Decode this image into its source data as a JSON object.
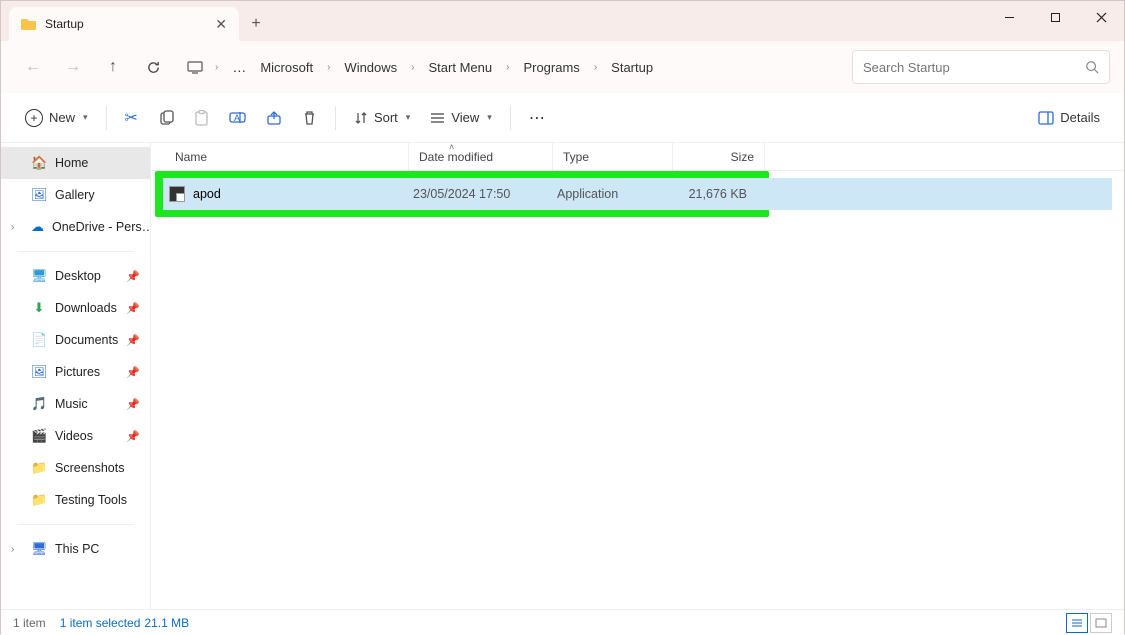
{
  "window": {
    "title": "Startup"
  },
  "breadcrumb": {
    "items": [
      "Microsoft",
      "Windows",
      "Start Menu",
      "Programs",
      "Startup"
    ]
  },
  "search": {
    "placeholder": "Search Startup"
  },
  "toolbar": {
    "new": "New",
    "sort": "Sort",
    "view": "View",
    "details": "Details"
  },
  "sidebar": {
    "home": "Home",
    "gallery": "Gallery",
    "onedrive": "OneDrive - Pers…",
    "desktop": "Desktop",
    "downloads": "Downloads",
    "documents": "Documents",
    "pictures": "Pictures",
    "music": "Music",
    "videos": "Videos",
    "screenshots": "Screenshots",
    "testing": "Testing Tools",
    "thispc": "This PC"
  },
  "columns": {
    "name": "Name",
    "date": "Date modified",
    "type": "Type",
    "size": "Size"
  },
  "files": [
    {
      "name": "apod",
      "date": "23/05/2024 17:50",
      "type": "Application",
      "size": "21,676 KB"
    }
  ],
  "status": {
    "count": "1 item",
    "selected": "1 item selected",
    "size": "21.1 MB"
  }
}
